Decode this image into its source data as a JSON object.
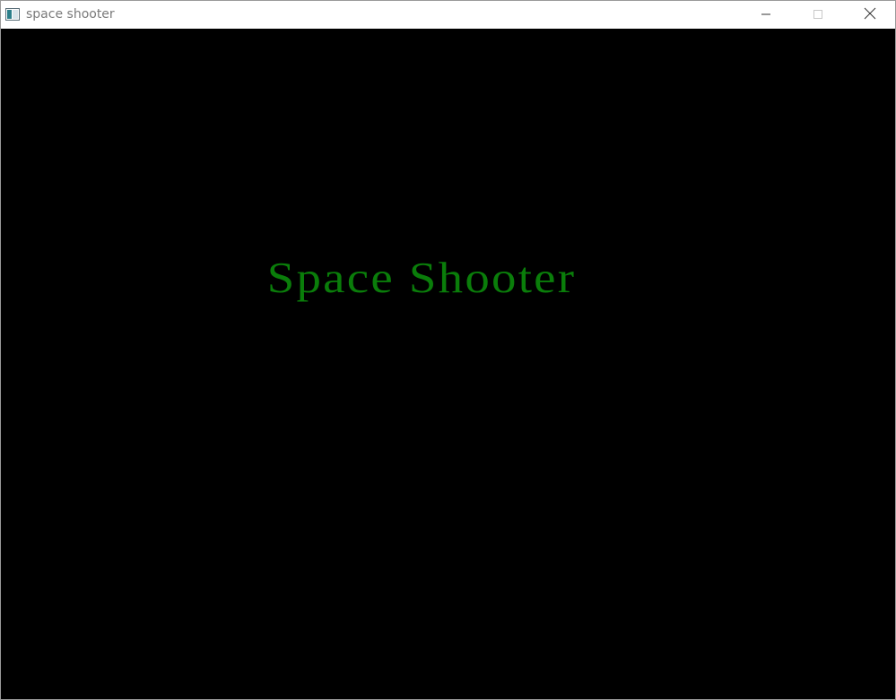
{
  "window": {
    "title": "space shooter",
    "icon": "application-window-icon",
    "controls": [
      "minimize-icon",
      "maximize-icon",
      "close-icon"
    ]
  },
  "game": {
    "title": "Space Shooter",
    "title_color": "#0a7d0a",
    "background": "#000000"
  }
}
